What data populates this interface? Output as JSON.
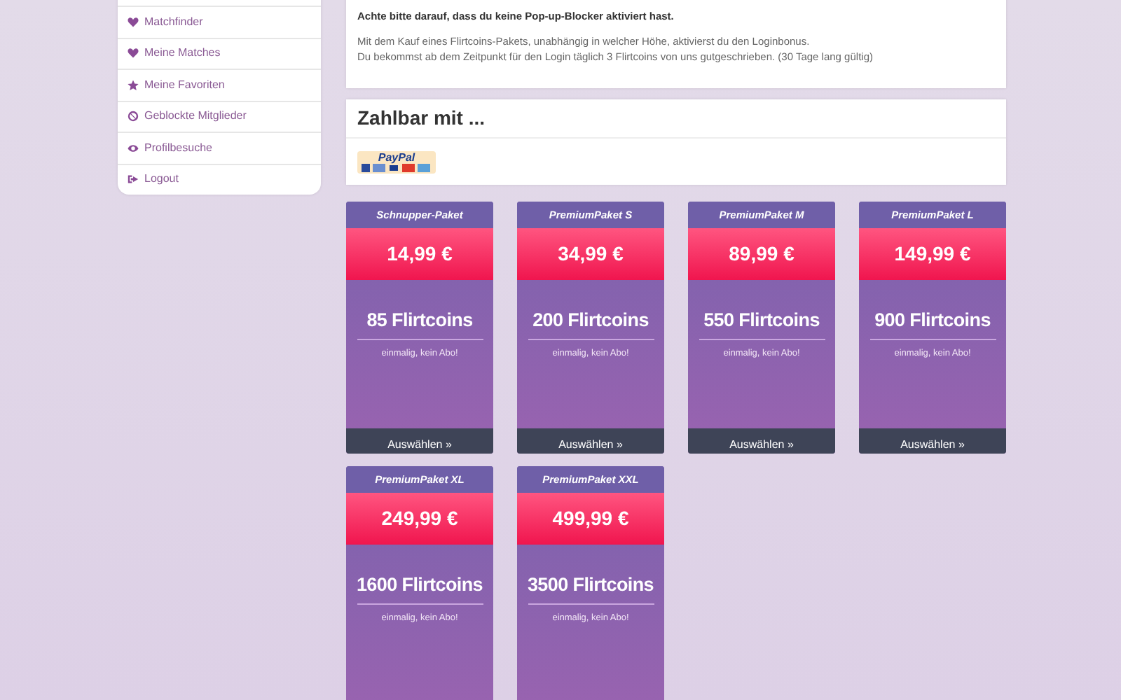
{
  "sidebar": {
    "items": [
      {
        "kind": "heart",
        "label": "Matchfinder"
      },
      {
        "kind": "heart",
        "label": "Meine Matches"
      },
      {
        "kind": "star",
        "label": "Meine Favoriten"
      },
      {
        "kind": "ban",
        "label": "Geblockte Mitglieder"
      },
      {
        "kind": "eye",
        "label": "Profilbesuche"
      },
      {
        "kind": "logout",
        "label": "Logout"
      }
    ]
  },
  "notice": {
    "warning": "Achte bitte darauf, dass du keine Pop-up-Blocker aktiviert hast.",
    "lines": [
      "Mit dem Kauf eines Flirtcoins-Pakets, unabhängig in welcher Höhe, aktivierst du den Loginbonus.",
      "Du bekommst ab dem Zeitpunkt für den Login täglich 3 Flirtcoins von uns gutgeschrieben. (30 Tage lang gültig)"
    ]
  },
  "payment": {
    "title": "Zahlbar mit ...",
    "logo_text": "PayPal"
  },
  "packages": [
    {
      "name": "Schnupper-Paket",
      "price": "14,99 €",
      "coins": "85 Flirtcoins",
      "note": "einmalig, kein Abo!",
      "button": "Auswählen »"
    },
    {
      "name": "PremiumPaket S",
      "price": "34,99 €",
      "coins": "200 Flirtcoins",
      "note": "einmalig, kein Abo!",
      "button": "Auswählen »"
    },
    {
      "name": "PremiumPaket M",
      "price": "89,99 €",
      "coins": "550 Flirtcoins",
      "note": "einmalig, kein Abo!",
      "button": "Auswählen »"
    },
    {
      "name": "PremiumPaket L",
      "price": "149,99 €",
      "coins": "900 Flirtcoins",
      "note": "einmalig, kein Abo!",
      "button": "Auswählen »"
    },
    {
      "name": "PremiumPaket XL",
      "price": "249,99 €",
      "coins": "1600 Flirtcoins",
      "note": "einmalig, kein Abo!"
    },
    {
      "name": "PremiumPaket XXL",
      "price": "499,99 €",
      "coins": "3500 Flirtcoins",
      "note": "einmalig, kein Abo!"
    }
  ]
}
